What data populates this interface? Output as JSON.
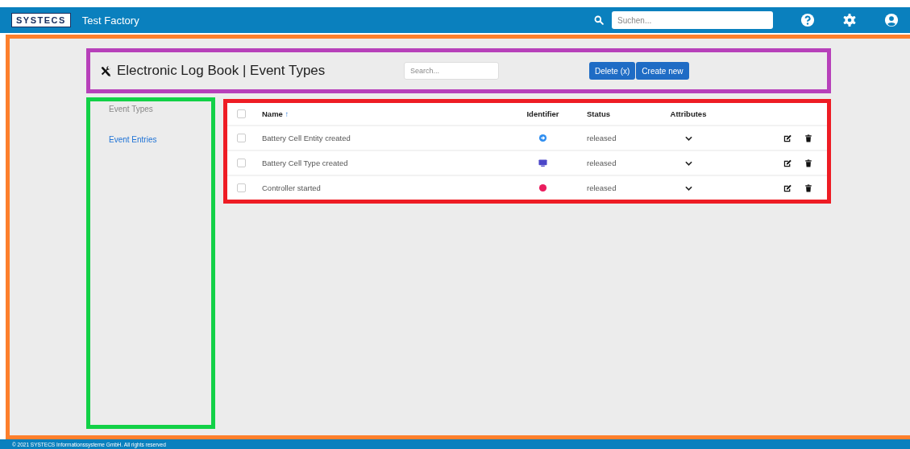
{
  "topbar": {
    "logo": "SYSTECS",
    "title": "Test Factory",
    "search": {
      "placeholder": "Suchen..."
    }
  },
  "header": {
    "title": "Electronic Log Book | Event Types",
    "search": {
      "placeholder": "Search..."
    },
    "buttons": [
      "Delete (x)",
      "Create new"
    ]
  },
  "sidebar": {
    "items": [
      {
        "label": "Event Types",
        "selected": true
      },
      {
        "label": "Event Entries",
        "selected": false
      }
    ]
  },
  "table": {
    "columns": [
      "Name",
      "Identifier",
      "Status",
      "Attributes"
    ],
    "sort_mark": "↑",
    "all_checked": false,
    "rows": [
      {
        "checked": false,
        "name": "Battery Cell Entity created",
        "identifier": {
          "kind": "arrow",
          "color": "#2f8ef0"
        },
        "status": "released"
      },
      {
        "checked": false,
        "name": "Battery Cell Type created",
        "identifier": {
          "kind": "monitor",
          "color": "#4b46c8"
        },
        "status": "released"
      },
      {
        "checked": false,
        "name": "Controller started",
        "identifier": {
          "kind": "dot",
          "color": "#ea1d5e"
        },
        "status": "released"
      }
    ]
  },
  "footer": "© 2021 SYSTECS Informationssysteme GmbH. All rights reserved"
}
